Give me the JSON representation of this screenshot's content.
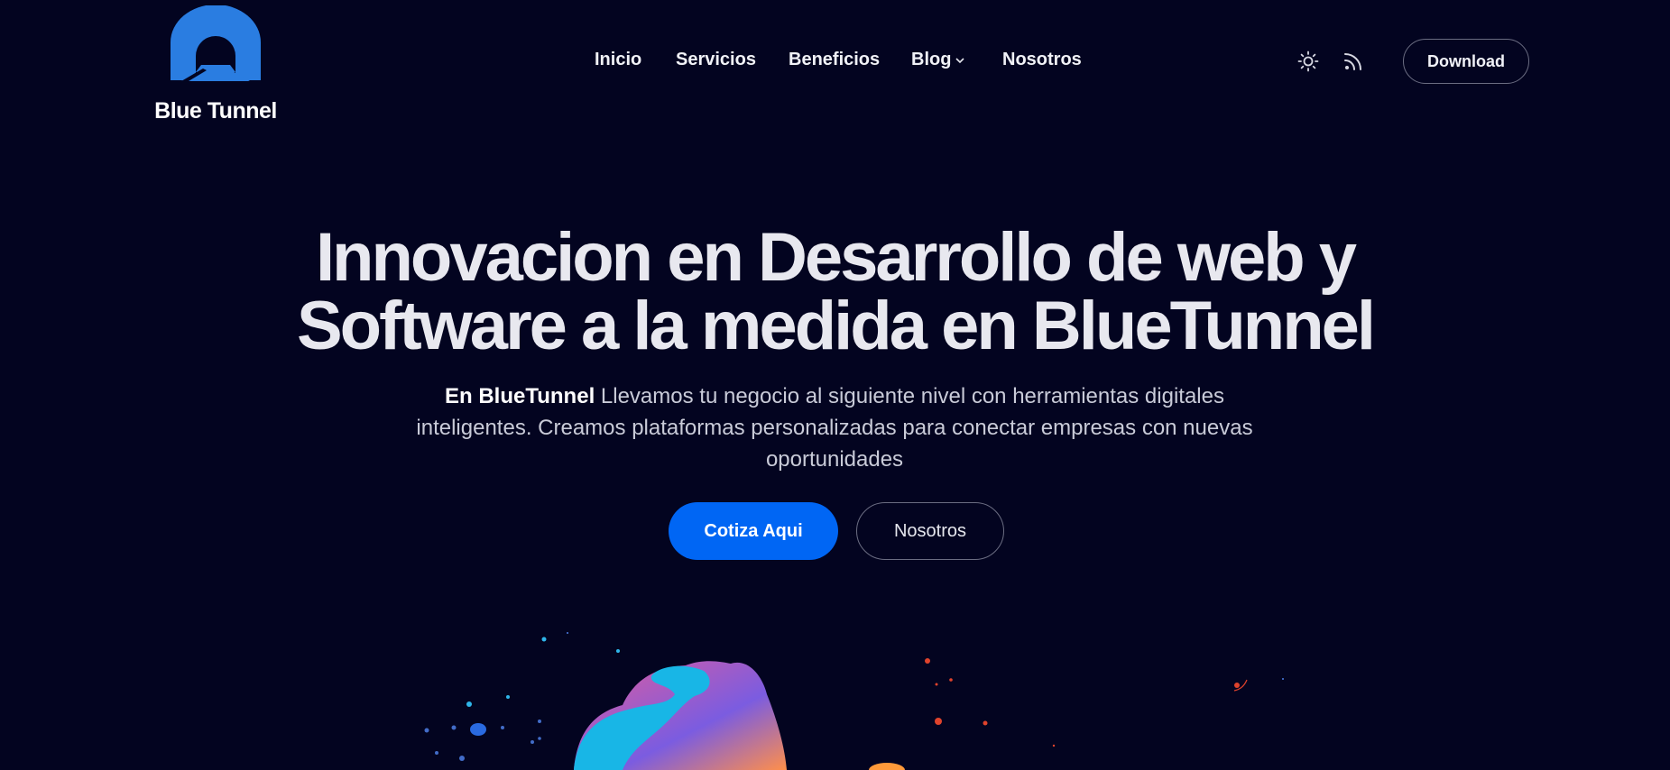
{
  "brand": {
    "name": "Blue Tunnel",
    "logo_icon": "tunnel-icon",
    "color": "#2a7de1"
  },
  "nav": {
    "items": [
      {
        "label": "Inicio"
      },
      {
        "label": "Servicios"
      },
      {
        "label": "Beneficios"
      },
      {
        "label": "Blog",
        "icon": "chevron-down-icon"
      },
      {
        "label": "Nosotros"
      }
    ]
  },
  "header_actions": {
    "theme_icon": "sun-icon",
    "rss_icon": "rss-icon",
    "download_label": "Download"
  },
  "hero": {
    "title_line1": "Innovacion en Desarrollo de web y",
    "title_line2": "Software a la medida en BlueTunnel",
    "subtitle_strong": "En BlueTunnel",
    "subtitle_rest": "Llevamos tu negocio al siguiente nivel con herramientas digitales inteligentes. Creamos plataformas personalizadas para conectar empresas con nuevas oportunidades",
    "cta_primary": "Cotiza Aqui",
    "cta_secondary": "Nosotros"
  },
  "colors": {
    "background": "#030420",
    "accent": "#0066f4"
  }
}
